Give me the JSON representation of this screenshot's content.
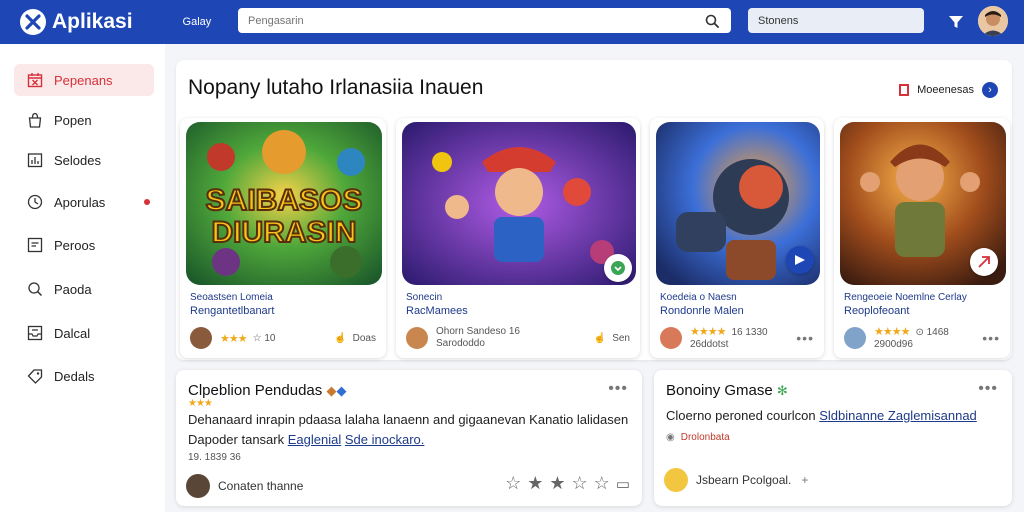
{
  "app": {
    "name": "Aplikasi",
    "nav_link": "Galay"
  },
  "search": {
    "placeholder": "Pengasarin",
    "secondary_placeholder": "Stonens"
  },
  "sidebar": {
    "items": [
      {
        "label": "Pepenans",
        "icon": "calendar-x-icon"
      },
      {
        "label": "Popen",
        "icon": "bag-icon"
      },
      {
        "label": "Selodes",
        "icon": "bar-chart-icon"
      },
      {
        "label": "Aporulas",
        "icon": "clock-icon"
      },
      {
        "label": "Peroos",
        "icon": "chart-square-icon"
      },
      {
        "label": "Paoda",
        "icon": "search-icon"
      },
      {
        "label": "Dalcal",
        "icon": "inbox-icon"
      },
      {
        "label": "Dedals",
        "icon": "tag-icon"
      }
    ]
  },
  "main": {
    "title": "Nopany lutaho Irlanasiia Inauen",
    "more_label": "Moeenesas",
    "cards": [
      {
        "thumb_text_1": "SAIBASOS",
        "thumb_text_2": "DIURASIN",
        "line1": "Seoastsen Lomeia",
        "line2": "Rengantetlbanart",
        "meta": "☆ 10",
        "right": "Doas"
      },
      {
        "line1": "Sonecin",
        "line2": "RacMamees",
        "meta": "Ohorn Sandeso 16",
        "meta2": "Sarododdo",
        "right": "Sen"
      },
      {
        "line1": "Koedeia o Naesn",
        "line2": "Rondonrle Malen",
        "meta": "16 1330",
        "meta2": "26ddotst"
      },
      {
        "line1": "Rengeoeie Noemlne Cerlay",
        "line2": "Reoplofeoant",
        "meta": "⊙ 1468",
        "meta2": "2900d96"
      }
    ]
  },
  "posts": [
    {
      "title": "Clpeblion Pendudas",
      "body_1": "Dehanaard inrapin pdaasa lalaha lanaenn and gigaanevan Kanatio lalidasen",
      "body_2_prefix": "Dapoder tansark",
      "link_1": "Eaglenial",
      "link_2": "Sde inockaro.",
      "date": "19. 1839 36",
      "author": "Conaten thanne"
    },
    {
      "title": "Bonoiny Gmase",
      "body_prefix": "Cloerno peroned courlcon",
      "link": "Sldbinanne Zaglemisannad",
      "tag": "Drolonbata",
      "author": "Jsbearn Pcolgoal."
    }
  ],
  "colors": {
    "brand": "#1e46b5",
    "accent_red": "#d63039",
    "star": "#f0a91c"
  }
}
